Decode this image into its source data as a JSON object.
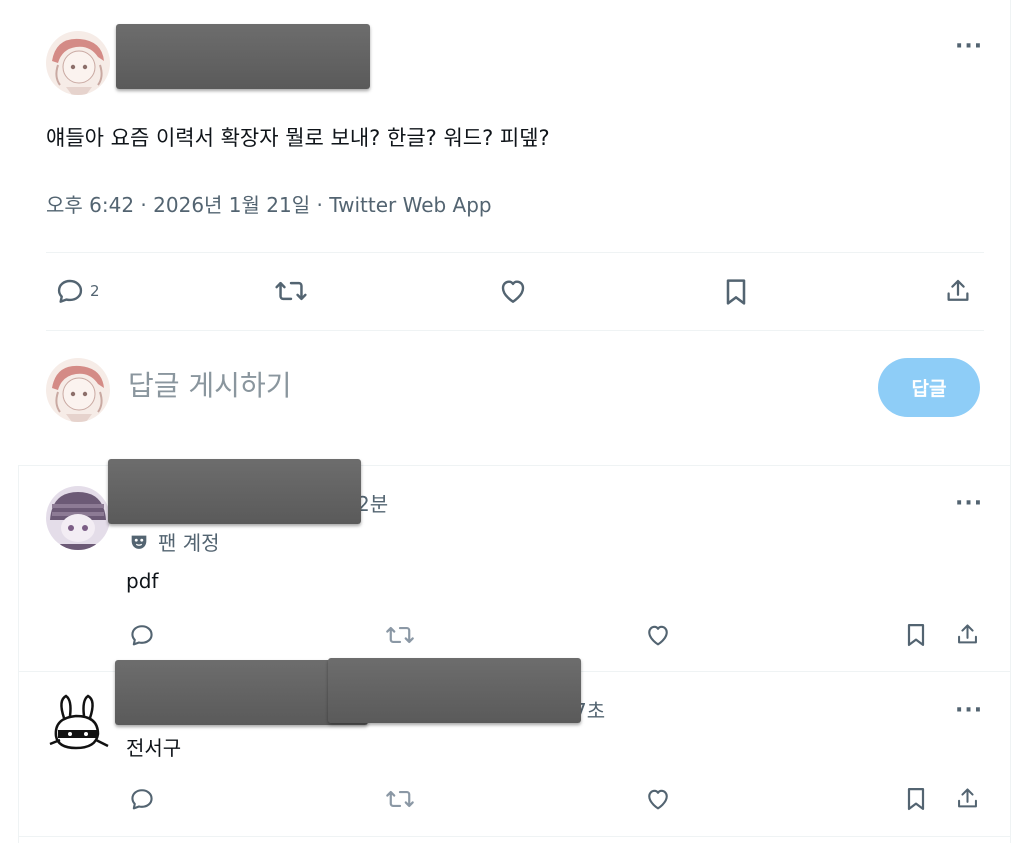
{
  "tweet": {
    "text": "얘들아 요즘 이력서 확장자 뭘로 보내? 한글? 워드? 피뎊?",
    "meta": "오후 6:42 · 2026년 1월 21일 · Twitter Web App",
    "reply_count": "2",
    "more_label": "···"
  },
  "compose": {
    "placeholder": "답글 게시하기",
    "button_label": "답글"
  },
  "replies": [
    {
      "time_fragment": "2분",
      "badge": "팬 계정",
      "text": "pdf",
      "more_label": "···"
    },
    {
      "time_fragment": "7초",
      "text": "전서구",
      "more_label": "···"
    }
  ],
  "colors": {
    "accent": "#1d9bf0",
    "reply_button_disabled": "#8ecdf7",
    "secondary_text": "#536471",
    "divider": "#eff3f4"
  },
  "icons": [
    "reply-icon",
    "retweet-icon",
    "like-icon",
    "bookmark-icon",
    "share-icon",
    "more-icon",
    "mask-icon"
  ]
}
